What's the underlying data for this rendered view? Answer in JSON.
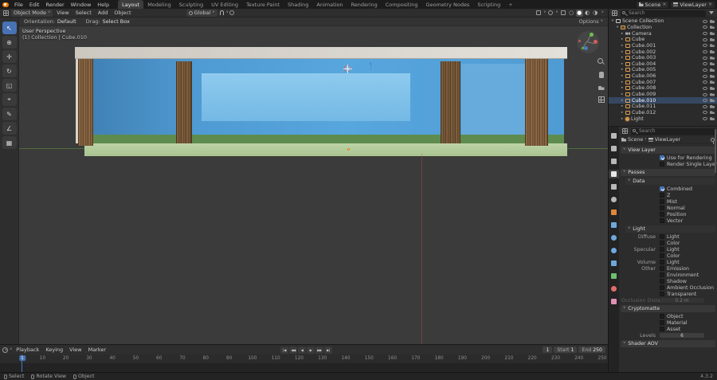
{
  "icons": {
    "chevron": "∨",
    "separator": "›",
    "close": "×"
  },
  "topbar": {
    "menus": [
      "File",
      "Edit",
      "Render",
      "Window",
      "Help"
    ],
    "workspaces": [
      "Layout",
      "Modeling",
      "Sculpting",
      "UV Editing",
      "Texture Paint",
      "Shading",
      "Animation",
      "Rendering",
      "Compositing",
      "Geometry Nodes",
      "Scripting"
    ],
    "active_workspace": "Layout",
    "add_workspace_label": "+",
    "scene_selector": {
      "label": "Scene"
    },
    "viewlayer_selector": {
      "label": "ViewLayer"
    }
  },
  "viewport_header": {
    "mode": "Object Mode",
    "menus": [
      "View",
      "Select",
      "Add",
      "Object"
    ],
    "transform_orientation": "Global",
    "shading_modes": [
      {
        "name": "wireframe",
        "glyph": "○",
        "active": false
      },
      {
        "name": "solid",
        "glyph": "●",
        "active": true
      },
      {
        "name": "material-preview",
        "glyph": "◐",
        "active": false
      },
      {
        "name": "rendered",
        "glyph": "◑",
        "active": false
      }
    ]
  },
  "tool_settings": {
    "orientation_label": "Orientation:",
    "orientation_value": "Default",
    "drag_label": "Drag:",
    "drag_value": "Select Box",
    "options_label": "Options"
  },
  "tools": [
    {
      "name": "tweak-select",
      "glyph": "↖",
      "active": true
    },
    {
      "name": "cursor",
      "glyph": "⊕",
      "active": false
    },
    {
      "name": "move",
      "glyph": "✛",
      "active": false
    },
    {
      "name": "rotate",
      "glyph": "↻",
      "active": false
    },
    {
      "name": "scale",
      "glyph": "◱",
      "active": false
    },
    {
      "name": "transform",
      "glyph": "⌖",
      "active": false
    },
    {
      "name": "annotate",
      "glyph": "✎",
      "active": false
    },
    {
      "name": "measure",
      "glyph": "∠",
      "active": false
    },
    {
      "name": "add-cube",
      "glyph": "▦",
      "active": false
    }
  ],
  "viewport": {
    "view_label": "User Perspective",
    "context_label": "(1) Collection | Cube.010"
  },
  "outliner": {
    "search_placeholder": "Search",
    "active_item": "Cube.010",
    "rows": [
      {
        "label": "Scene Collection",
        "depth": 0,
        "type": "scene-collection",
        "arrow": "▾"
      },
      {
        "label": "Collection",
        "depth": 1,
        "type": "collection",
        "arrow": "▾"
      },
      {
        "label": "Camera",
        "depth": 2,
        "type": "camera",
        "arrow": "▸"
      },
      {
        "label": "Cube",
        "depth": 2,
        "type": "mesh",
        "arrow": "▸"
      },
      {
        "label": "Cube.001",
        "depth": 2,
        "type": "mesh",
        "arrow": "▸"
      },
      {
        "label": "Cube.002",
        "depth": 2,
        "type": "mesh",
        "arrow": "▸"
      },
      {
        "label": "Cube.003",
        "depth": 2,
        "type": "mesh",
        "arrow": "▸"
      },
      {
        "label": "Cube.004",
        "depth": 2,
        "type": "mesh",
        "arrow": "▸"
      },
      {
        "label": "Cube.005",
        "depth": 2,
        "type": "mesh",
        "arrow": "▸"
      },
      {
        "label": "Cube.006",
        "depth": 2,
        "type": "mesh",
        "arrow": "▸"
      },
      {
        "label": "Cube.007",
        "depth": 2,
        "type": "mesh",
        "arrow": "▸"
      },
      {
        "label": "Cube.008",
        "depth": 2,
        "type": "mesh",
        "arrow": "▸"
      },
      {
        "label": "Cube.009",
        "depth": 2,
        "type": "mesh",
        "arrow": "▸"
      },
      {
        "label": "Cube.010",
        "depth": 2,
        "type": "mesh",
        "arrow": "▸"
      },
      {
        "label": "Cube.011",
        "depth": 2,
        "type": "mesh",
        "arrow": "▸"
      },
      {
        "label": "Cube.012",
        "depth": 2,
        "type": "mesh",
        "arrow": "▸"
      },
      {
        "label": "Light",
        "depth": 2,
        "type": "light",
        "arrow": "▸"
      }
    ]
  },
  "properties": {
    "search_placeholder": "Search",
    "breadcrumb": {
      "scene": "Scene",
      "layer": "ViewLayer"
    },
    "active_tab": "view-layer",
    "tabs": [
      {
        "name": "tool",
        "color": "#b8b8b8",
        "round": false
      },
      {
        "name": "render",
        "color": "#b8b8b8",
        "round": false
      },
      {
        "name": "output",
        "color": "#b8b8b8",
        "round": false
      },
      {
        "name": "view-layer",
        "color": "#e8e8e8",
        "round": false
      },
      {
        "name": "scene",
        "color": "#b8b8b8",
        "round": false
      },
      {
        "name": "world",
        "color": "#b8b8b8",
        "round": true
      },
      {
        "name": "object",
        "color": "#e0883a",
        "round": false
      },
      {
        "name": "modifiers",
        "color": "#6fa8dc",
        "round": false
      },
      {
        "name": "particles",
        "color": "#6fa8dc",
        "round": true
      },
      {
        "name": "physics",
        "color": "#6fa8dc",
        "round": true
      },
      {
        "name": "constraints",
        "color": "#6fa8dc",
        "round": false
      },
      {
        "name": "object-data",
        "color": "#6fbf6f",
        "round": false
      },
      {
        "name": "material",
        "color": "#e06c6c",
        "round": true
      },
      {
        "name": "texture",
        "color": "#e08fb5",
        "round": false
      }
    ],
    "view_layer": {
      "title": "View Layer",
      "rows": [
        {
          "label": "Use for Rendering",
          "checked": true
        },
        {
          "label": "Render Single Layer",
          "checked": false
        }
      ]
    },
    "passes": {
      "title": "Passes",
      "data": {
        "title": "Data",
        "rows": [
          {
            "label": "Combined",
            "checked": true
          },
          {
            "label": "Z",
            "checked": false
          },
          {
            "label": "Mist",
            "checked": false
          },
          {
            "label": "Normal",
            "checked": false
          },
          {
            "label": "Position",
            "checked": false
          },
          {
            "label": "Vector",
            "checked": false
          }
        ]
      },
      "light": {
        "title": "Light",
        "rows": [
          {
            "group": "Diffuse",
            "label": "Light",
            "checked": false
          },
          {
            "group": "",
            "label": "Color",
            "checked": false
          },
          {
            "group": "Specular",
            "label": "Light",
            "checked": false
          },
          {
            "group": "",
            "label": "Color",
            "checked": false
          },
          {
            "group": "Volume",
            "label": "Light",
            "checked": false
          },
          {
            "group": "Other",
            "label": "Emission",
            "checked": false
          },
          {
            "group": "",
            "label": "Environment",
            "checked": false
          },
          {
            "group": "",
            "label": "Shadow",
            "checked": false
          },
          {
            "group": "",
            "label": "Ambient Occlusion",
            "checked": false
          },
          {
            "group": "",
            "label": "Transparent",
            "checked": false
          }
        ],
        "occlusion_label": "Occlusion Distance",
        "occlusion_value": "0.2 m"
      }
    },
    "cryptomatte": {
      "title": "Cryptomatte",
      "rows": [
        {
          "label": "Object",
          "checked": false
        },
        {
          "label": "Material",
          "checked": false
        },
        {
          "label": "Asset",
          "checked": false
        }
      ],
      "levels_label": "Levels",
      "levels_value": "6"
    },
    "shader_aov": {
      "title": "Shader AOV"
    }
  },
  "timeline": {
    "menus": [
      "Playback",
      "Keying",
      "View",
      "Marker"
    ],
    "transport": [
      {
        "name": "jump-to-start",
        "glyph": "|◀"
      },
      {
        "name": "previous-keyframe",
        "glyph": "◀◀"
      },
      {
        "name": "play-reverse",
        "glyph": "◀"
      },
      {
        "name": "play",
        "glyph": "▶"
      },
      {
        "name": "next-keyframe",
        "glyph": "▶▶"
      },
      {
        "name": "jump-to-end",
        "glyph": "▶|"
      }
    ],
    "current_frame": "1",
    "start_label": "Start",
    "start_value": "1",
    "end_label": "End",
    "end_value": "250",
    "playhead_frame": 1,
    "ticks": [
      10,
      20,
      30,
      40,
      50,
      60,
      70,
      80,
      90,
      100,
      110,
      120,
      130,
      140,
      150,
      160,
      170,
      180,
      190,
      200,
      210,
      220,
      230,
      240,
      250
    ]
  },
  "statusbar": {
    "items": [
      "Select",
      "Rotate View",
      "Object"
    ],
    "version": "4.3.2"
  },
  "colors": {
    "accent": "#4772b3",
    "selection_orange": "#e0883a"
  }
}
